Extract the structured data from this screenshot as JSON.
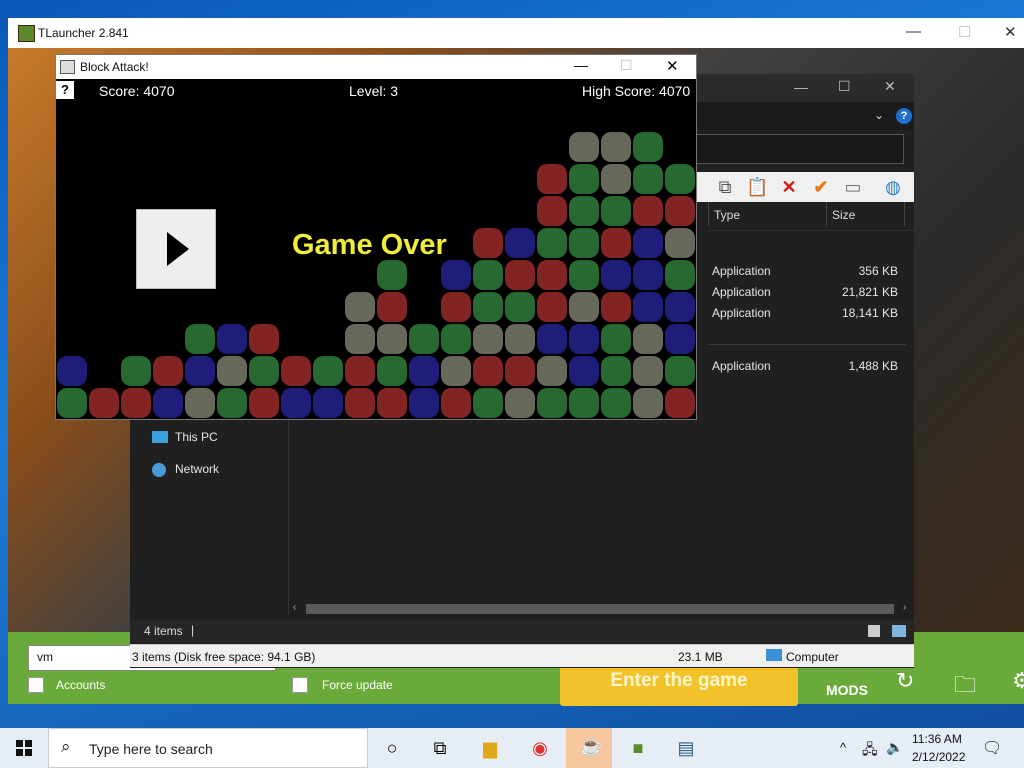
{
  "tlauncher": {
    "title": "TLauncher 2.841",
    "username": "vm",
    "accounts_label": "Accounts",
    "force_update_label": "Force update",
    "enter_button": "Enter the game",
    "mods_logo": "MODS"
  },
  "explorer": {
    "columns": {
      "type": "Type",
      "size": "Size"
    },
    "rows": [
      {
        "type": "Application",
        "size": "356 KB"
      },
      {
        "type": "Application",
        "size": "21,821 KB"
      },
      {
        "type": "Application",
        "size": "18,141 KB"
      },
      {
        "type": "Application",
        "size": "1,488 KB"
      }
    ],
    "nav": [
      {
        "label": "This PC"
      },
      {
        "label": "Network"
      }
    ],
    "items_count": "4 items",
    "status_left": "3 items (Disk free space: 94.1 GB)",
    "status_size": "23.1 MB",
    "status_location": "Computer"
  },
  "blockattack": {
    "title": "Block Attack!",
    "score": "Score: 4070",
    "level": "Level: 3",
    "high_score": "High Score: 4070",
    "help": "?",
    "game_over": "Game Over"
  },
  "taskbar": {
    "search_placeholder": "Type here to search",
    "time": "11:36 AM",
    "date": "2/12/2022"
  },
  "colors": {
    "block_red": "#9a2a2a",
    "block_green": "#2f7a3a",
    "block_blue": "#23238f",
    "block_gray": "#7a7a6a",
    "accent_green": "#6aaa3a",
    "enter_yellow": "#f2c22a",
    "game_over_yellow": "#f2ec3a"
  }
}
